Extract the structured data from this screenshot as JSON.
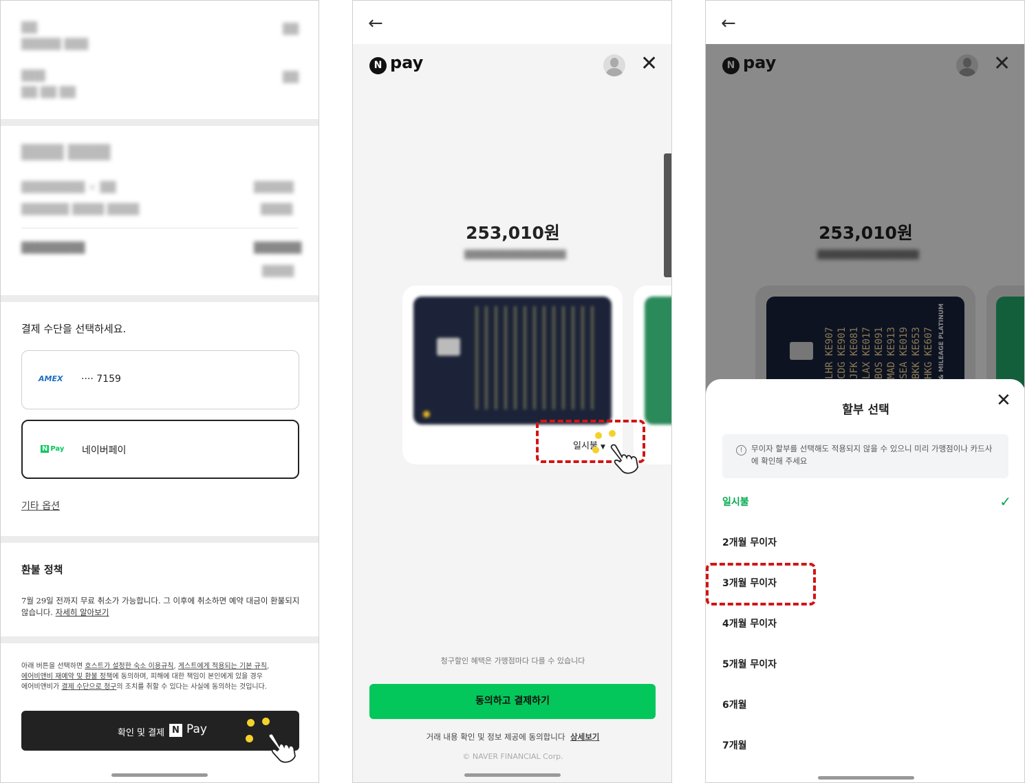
{
  "panel1": {
    "payment_section_title": "결제 수단을 선택하세요.",
    "amex_brand": "AMEX",
    "amex_masked": "···· 7159",
    "npay_badge": "N Pay",
    "npay_label": "네이버페이",
    "other_options": "기타 옵션",
    "refund_title": "환불 정책",
    "refund_text_1": "7월 29일 전까지 무료 취소가 가능합니다. 그 이후에 취소하면 예약 대금이 환불되지",
    "refund_text_2": "않습니다.",
    "refund_link": "자세히 알아보기",
    "terms_1a": "아래 버튼을 선택하면 ",
    "terms_1b": "호스트가 설정한 숙소 이용규칙",
    "terms_1c": ", ",
    "terms_1d": "게스트에게 적용되는 기본 규칙",
    "terms_1e": ",",
    "terms_2a": "에어비앤비 재예약 및 환불 정책",
    "terms_2b": "에 동의하며, 피해에 대한 책임이 본인에게 있을 경우",
    "terms_3a": "에어비앤비가 ",
    "terms_3b": "결제 수단으로 청구",
    "terms_3c": "의 조치를 취할 수 있다는 사실에 동의하는 것입니다.",
    "confirm_button": "확인 및 결제",
    "confirm_pay": "Pay",
    "confirm_n": "N"
  },
  "panel2": {
    "logo_n": "N",
    "logo_text": "pay",
    "amount": "253,010원",
    "installment_label": "일시불",
    "discount_note": "청구할인 혜택은 가맹점마다 다를 수 있습니다",
    "agree_button": "동의하고 결제하기",
    "consent_text": "거래 내용 확인 및 정보 제공에 동의합니다",
    "consent_link": "상세보기",
    "copyright": "© NAVER FINANCIAL Corp."
  },
  "panel3": {
    "logo_n": "N",
    "logo_text": "pay",
    "amount": "253,010원",
    "sheet_title": "할부 선택",
    "notice": "무이자 할부를 선택해도 적용되지 않을 수 있으니 미리 가맹점이나 카드사에 확인해 주세요",
    "options": [
      "일시불",
      "2개월 무이자",
      "3개월 무이자",
      "4개월 무이자",
      "5개월 무이자",
      "6개월",
      "7개월"
    ],
    "selected_index": 0,
    "highlighted_index": 2,
    "card_codes": [
      "LHR KE907",
      "CDG KE901",
      "JFK KE081",
      "LAX KE017",
      "BOS KE091",
      "MAD KE913",
      "SEA KE019",
      "BKK KE653",
      "HKG KE607"
    ],
    "card_tier": "& MILEAGE PLATINUM"
  },
  "colors": {
    "naver_green": "#03c75a",
    "highlight_red": "#d21414",
    "dark": "#222222",
    "tap_yellow": "#f3d22b"
  }
}
